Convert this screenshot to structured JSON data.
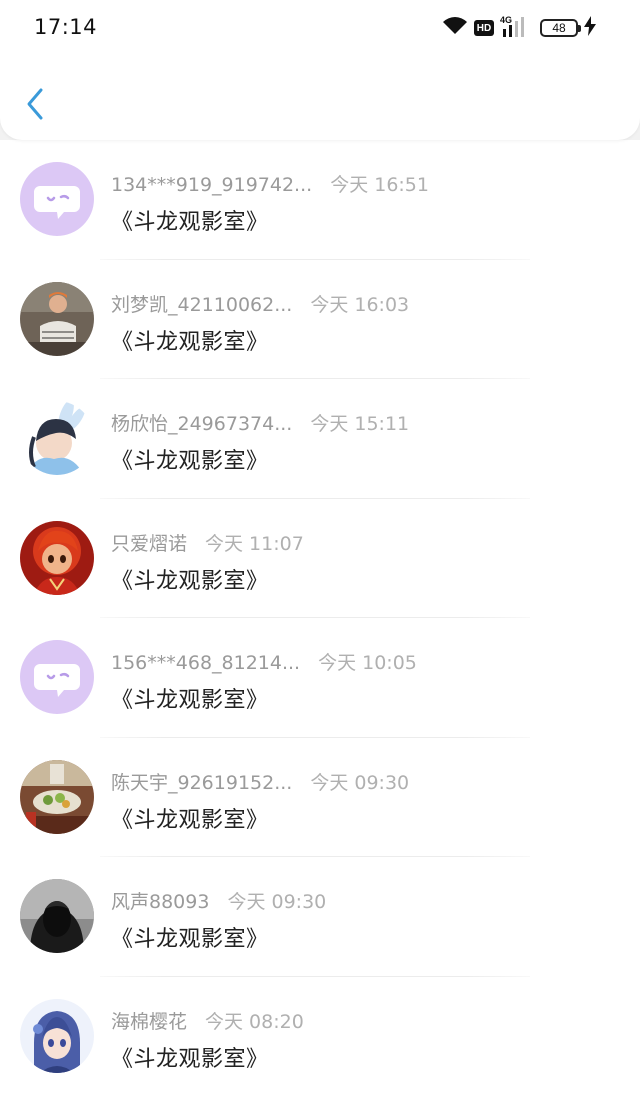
{
  "status_bar": {
    "time": "17:14",
    "hd_label": "HD",
    "network_label": "4G",
    "battery": "48"
  },
  "conversations": [
    {
      "name": "134***919_919742...",
      "time": "今天 16:51",
      "message": "《斗龙观影室》",
      "avatar": "default-chat-bubble"
    },
    {
      "name": "刘梦凯_42110062...",
      "time": "今天 16:03",
      "message": "《斗龙观影室》",
      "avatar": "photo-person"
    },
    {
      "name": "杨欣怡_24967374...",
      "time": "今天 15:11",
      "message": "《斗龙观影室》",
      "avatar": "anime-girl-bunny-ears"
    },
    {
      "name": "只爱熠诺",
      "time": "今天 11:07",
      "message": "《斗龙观影室》",
      "avatar": "cartoon-red-character"
    },
    {
      "name": "156***468_81214...",
      "time": "今天 10:05",
      "message": "《斗龙观影室》",
      "avatar": "default-chat-bubble"
    },
    {
      "name": "陈天宇_92619152...",
      "time": "今天 09:30",
      "message": "《斗龙观影室》",
      "avatar": "photo-food"
    },
    {
      "name": "风声88093",
      "time": "今天 09:30",
      "message": "《斗龙观影室》",
      "avatar": "dark-hooded-figure"
    },
    {
      "name": "海棉樱花",
      "time": "今天 08:20",
      "message": "《斗龙观影室》",
      "avatar": "anime-girl-blue-hair"
    }
  ],
  "colors": {
    "accent": "#3a9ad9",
    "default_avatar_bg": "#dcc8f5",
    "name_text": "#9a9a9a",
    "message_text": "#222222"
  }
}
